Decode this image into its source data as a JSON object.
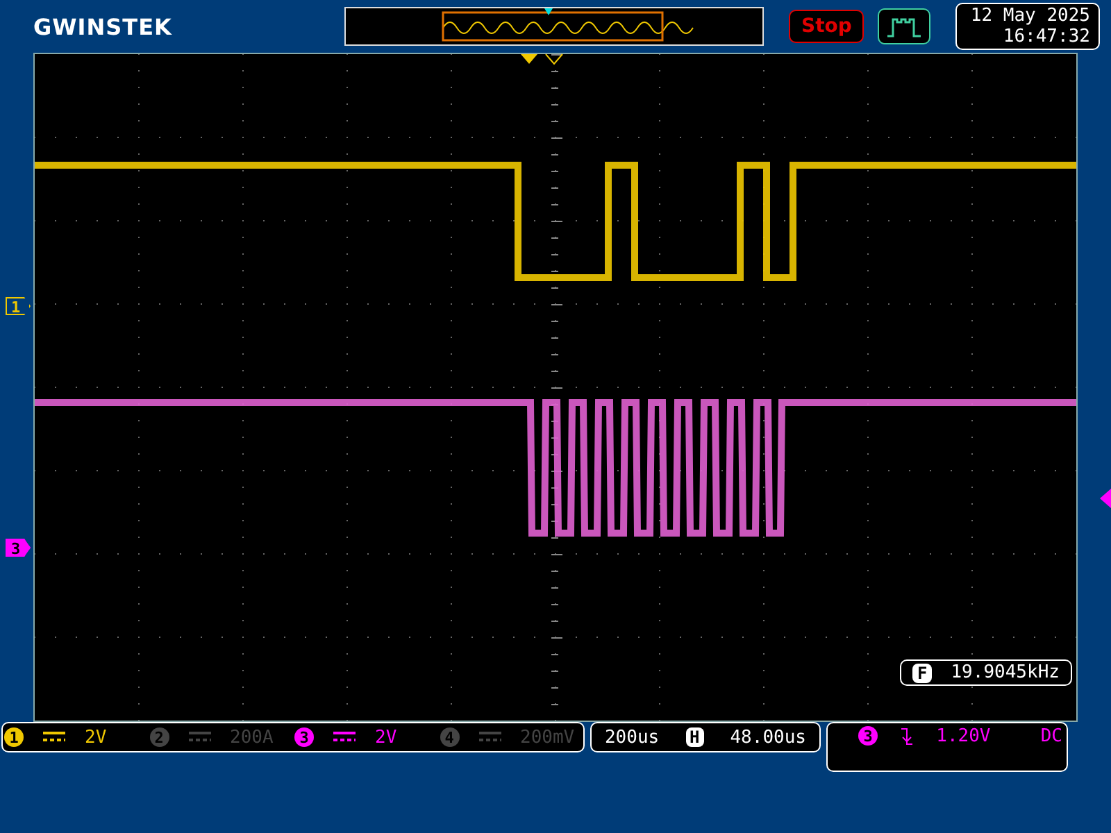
{
  "header": {
    "logo": "GWINSTEK",
    "run_state": "Stop",
    "date": "12 May 2025",
    "time": "16:47:32"
  },
  "markers": [
    {
      "label": "1",
      "color": "#f0c800"
    },
    {
      "label": "3",
      "color": "#ff00ff"
    }
  ],
  "frequency": {
    "badge": "F",
    "value": "19.9045kHz"
  },
  "channels": [
    {
      "number": "1",
      "scale": "2V",
      "on": true
    },
    {
      "number": "2",
      "scale": "200A",
      "on": false
    },
    {
      "number": "3",
      "scale": "2V",
      "on": true
    },
    {
      "number": "4",
      "scale": "200mV",
      "on": false
    }
  ],
  "timebase": {
    "scale": "200us",
    "badge": "H",
    "position": "48.00us"
  },
  "trigger": {
    "source": "3",
    "level": "1.20V",
    "coupling": "DC",
    "color": "#ff00ff"
  }
}
